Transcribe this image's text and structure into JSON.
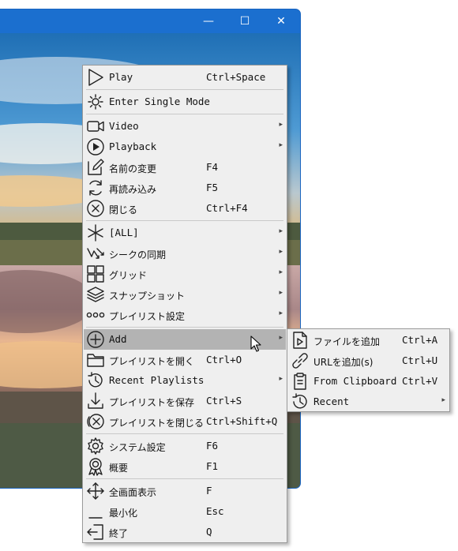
{
  "window": {
    "minimize_glyph": "—",
    "maximize_glyph": "☐",
    "close_glyph": "✕"
  },
  "main_menu": {
    "items": [
      {
        "id": "play",
        "icon": "play-icon",
        "label": "Play",
        "shortcut": "Ctrl+Space",
        "submenu": false
      },
      {
        "id": "single-mode",
        "icon": "single-mode-icon",
        "label": "Enter Single Mode",
        "shortcut": "",
        "submenu": false
      },
      {
        "id": "video",
        "icon": "video-camera-icon",
        "label": "Video",
        "shortcut": "",
        "submenu": true
      },
      {
        "id": "playback",
        "icon": "playback-circle-icon",
        "label": "Playback",
        "shortcut": "",
        "submenu": true
      },
      {
        "id": "rename",
        "icon": "edit-icon",
        "label": "名前の変更",
        "shortcut": "F4",
        "submenu": false
      },
      {
        "id": "reload",
        "icon": "reload-icon",
        "label": "再読み込み",
        "shortcut": "F5",
        "submenu": false
      },
      {
        "id": "close",
        "icon": "close-circle-icon",
        "label": "閉じる",
        "shortcut": "Ctrl+F4",
        "submenu": false
      },
      {
        "id": "all",
        "icon": "asterisk-icon",
        "label": "[ALL]",
        "shortcut": "",
        "submenu": true
      },
      {
        "id": "seek-sync",
        "icon": "seek-sync-icon",
        "label": "シークの同期",
        "shortcut": "",
        "submenu": true
      },
      {
        "id": "grid",
        "icon": "grid-icon",
        "label": "グリッド",
        "shortcut": "",
        "submenu": true
      },
      {
        "id": "snapshot",
        "icon": "layers-icon",
        "label": "スナップショット",
        "shortcut": "",
        "submenu": true
      },
      {
        "id": "playlist-settings",
        "icon": "playlist-dots-icon",
        "label": "プレイリスト設定",
        "shortcut": "",
        "submenu": true
      },
      {
        "id": "add",
        "icon": "add-circle-icon",
        "label": "Add",
        "shortcut": "",
        "submenu": true
      },
      {
        "id": "open-playlist",
        "icon": "folder-icon",
        "label": "プレイリストを開く",
        "shortcut": "Ctrl+O",
        "submenu": false
      },
      {
        "id": "recent-playlists",
        "icon": "history-icon",
        "label": "Recent Playlists",
        "shortcut": "",
        "submenu": true
      },
      {
        "id": "save-playlist",
        "icon": "save-down-icon",
        "label": "プレイリストを保存",
        "shortcut": "Ctrl+S",
        "submenu": false
      },
      {
        "id": "close-playlist",
        "icon": "close-playlist-icon",
        "label": "プレイリストを閉じる",
        "shortcut": "Ctrl+Shift+Q",
        "submenu": false
      },
      {
        "id": "system-settings",
        "icon": "gear-icon",
        "label": "システム設定",
        "shortcut": "F6",
        "submenu": false
      },
      {
        "id": "about",
        "icon": "award-icon",
        "label": "概要",
        "shortcut": "F1",
        "submenu": false
      },
      {
        "id": "fullscreen",
        "icon": "fullscreen-arrows-icon",
        "label": "全画面表示",
        "shortcut": "F",
        "submenu": false
      },
      {
        "id": "minimize",
        "icon": "minimize-icon",
        "label": "最小化",
        "shortcut": "Esc",
        "submenu": false
      },
      {
        "id": "exit",
        "icon": "exit-icon",
        "label": "終了",
        "shortcut": "Q",
        "submenu": false
      }
    ]
  },
  "add_submenu": {
    "items": [
      {
        "id": "add-file",
        "icon": "add-file-icon",
        "label": "ファイルを追加",
        "shortcut": "Ctrl+A",
        "submenu": false
      },
      {
        "id": "add-url",
        "icon": "link-icon",
        "label": "URLを追加(s)",
        "shortcut": "Ctrl+U",
        "submenu": false
      },
      {
        "id": "from-clipboard",
        "icon": "clipboard-icon",
        "label": "From Clipboard",
        "shortcut": "Ctrl+V",
        "submenu": false
      },
      {
        "id": "recent",
        "icon": "history-icon",
        "label": "Recent",
        "shortcut": "",
        "submenu": true
      }
    ]
  },
  "arrow_glyph": "▸",
  "colors": {
    "title_bar": "#1b6fcf",
    "menu_background": "#efefef",
    "highlight": "#b3b3b3"
  }
}
